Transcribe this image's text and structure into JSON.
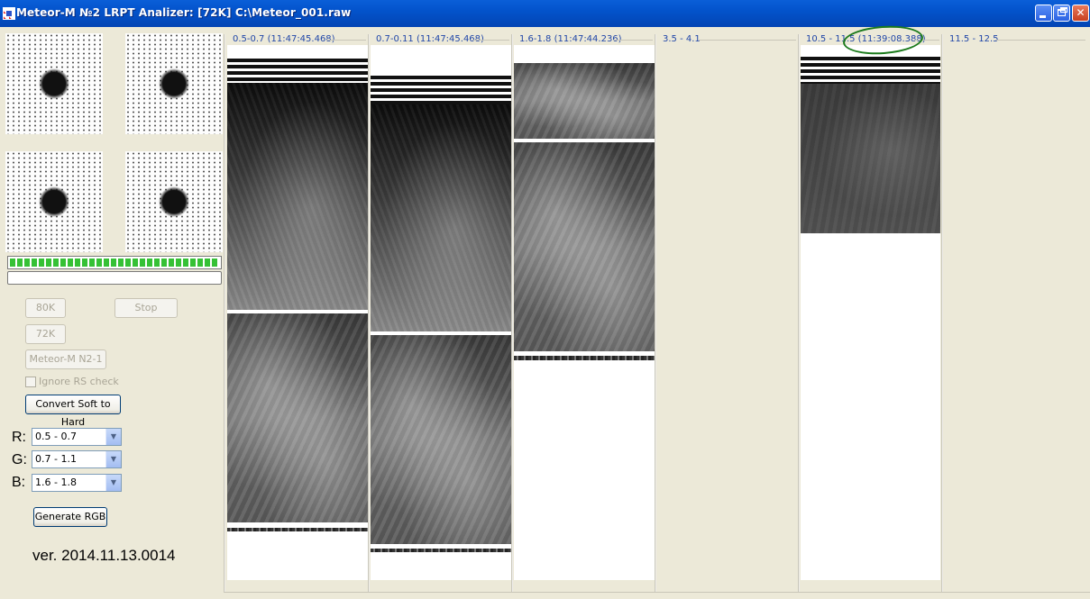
{
  "window": {
    "title": "Meteor-M №2 LRPT Analizer: [72K] C:\\Meteor_001.raw",
    "colors": {
      "titlebar": "#0353cb",
      "annotation": "#1b7a1b",
      "channel_label": "#2046a8"
    }
  },
  "signal": {
    "progress_fraction": 1.0
  },
  "controls": {
    "btn_80k": "80K",
    "btn_stop": "Stop",
    "btn_72k": "72K",
    "btn_meteor": "Meteor-M N2-1",
    "ignore_rs_label": "Ignore RS check",
    "convert_label": "Convert Soft to Hard",
    "r_label": "R:",
    "g_label": "G:",
    "b_label": "B:",
    "r_value": "0.5 - 0.7",
    "g_value": "0.7 - 1.1",
    "b_value": "1.6 - 1.8",
    "generate_label": "Generate RGB"
  },
  "version": "ver. 2014.11.13.0014",
  "channels": [
    {
      "label": "0.5-0.7 (11:47:45.468)"
    },
    {
      "label": "0.7-0.11 (11:47:45.468)"
    },
    {
      "label": "1.6-1.8 (11:47:44.236)"
    },
    {
      "label": "3.5 - 4.1"
    },
    {
      "label": "10.5 - 11.5 (11:39:08.388)"
    },
    {
      "label": "11.5 - 12.5"
    }
  ],
  "icons": {
    "app": "meteor-app-icon",
    "minimize": "minimize-icon",
    "maximize": "restore-icon",
    "close": "close-icon",
    "dropdown": "chevron-down-icon"
  }
}
